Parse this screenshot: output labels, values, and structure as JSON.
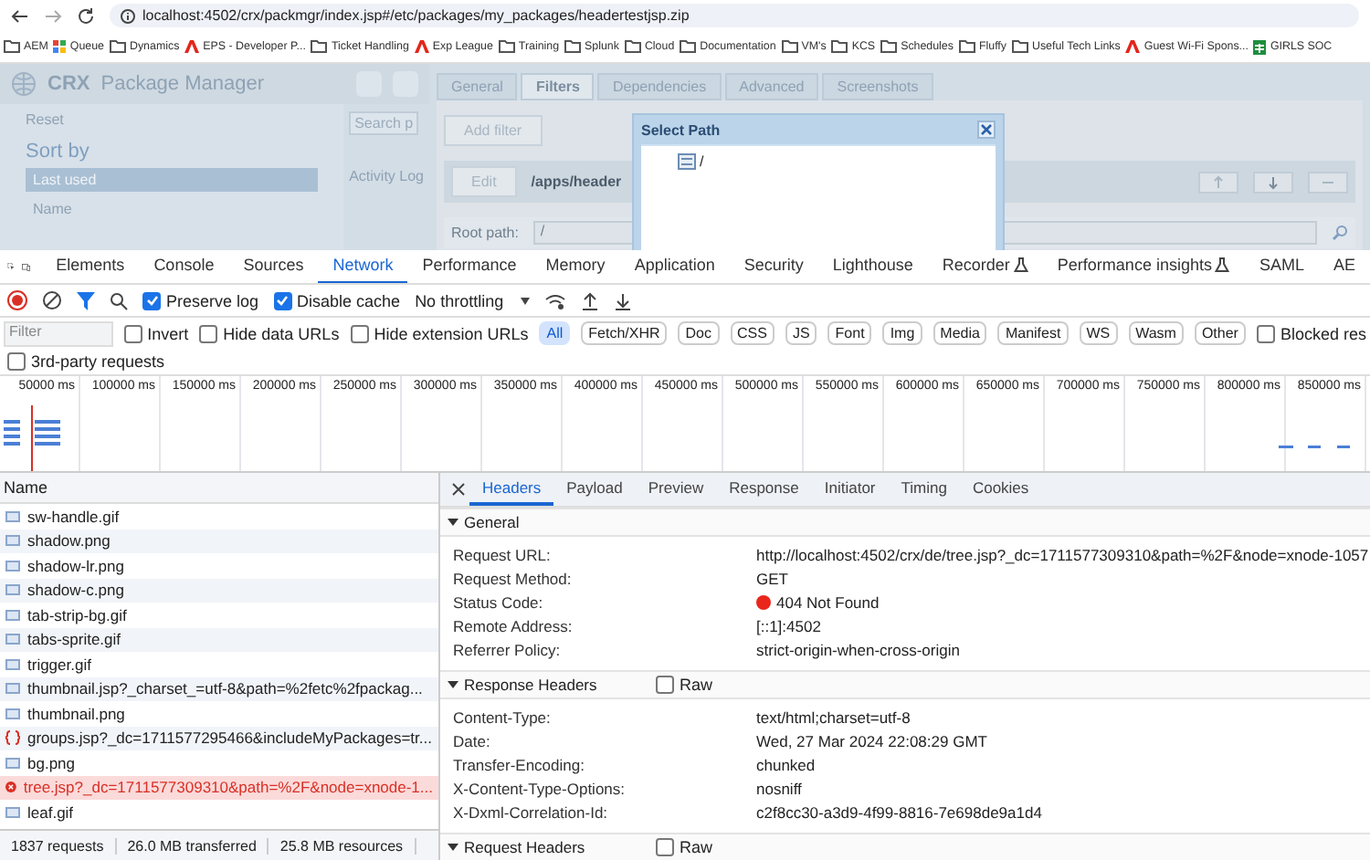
{
  "browser": {
    "address": "localhost:4502/crx/packmgr/index.jsp#/etc/packages/my_packages/headertestjsp.zip",
    "bookmarks": [
      {
        "label": "AEM",
        "kind": "folder"
      },
      {
        "label": "Queue",
        "kind": "app"
      },
      {
        "label": "Dynamics",
        "kind": "folder"
      },
      {
        "label": "EPS - Developer P...",
        "kind": "adobe"
      },
      {
        "label": "Ticket Handling",
        "kind": "folder"
      },
      {
        "label": "Exp League",
        "kind": "adobe"
      },
      {
        "label": "Training",
        "kind": "folder"
      },
      {
        "label": "Splunk",
        "kind": "folder"
      },
      {
        "label": "Cloud",
        "kind": "folder"
      },
      {
        "label": "Documentation",
        "kind": "folder"
      },
      {
        "label": "VM's",
        "kind": "folder"
      },
      {
        "label": "KCS",
        "kind": "folder"
      },
      {
        "label": "Schedules",
        "kind": "folder"
      },
      {
        "label": "Fluffy",
        "kind": "folder"
      },
      {
        "label": "Useful Tech Links",
        "kind": "folder"
      },
      {
        "label": "Guest Wi-Fi Spons...",
        "kind": "adobe"
      },
      {
        "label": "GIRLS SOC",
        "kind": "sheet"
      }
    ]
  },
  "crx": {
    "logo_a": "CRX",
    "logo_b": "Package Manager",
    "reset": "Reset",
    "search_placeholder": "Search p",
    "sort_title": "Sort by",
    "sort_options": [
      {
        "label": "Last used",
        "selected": true
      },
      {
        "label": "Name",
        "selected": false
      }
    ],
    "activity_log": "Activity Log",
    "tabs": [
      {
        "label": "General",
        "selected": false
      },
      {
        "label": "Filters",
        "selected": true
      },
      {
        "label": "Dependencies",
        "selected": false
      },
      {
        "label": "Advanced",
        "selected": false
      },
      {
        "label": "Screenshots",
        "selected": false
      }
    ],
    "add_filter": "Add filter",
    "edit": "Edit",
    "filter_path": "/apps/header",
    "root_path_label": "Root path:",
    "root_path_value": "/",
    "dialog": {
      "title": "Select Path",
      "tree_root": "/"
    }
  },
  "devtools": {
    "tabs": [
      {
        "label": "Elements",
        "selected": false,
        "experimental": false
      },
      {
        "label": "Console",
        "selected": false,
        "experimental": false
      },
      {
        "label": "Sources",
        "selected": false,
        "experimental": false
      },
      {
        "label": "Network",
        "selected": true,
        "experimental": false
      },
      {
        "label": "Performance",
        "selected": false,
        "experimental": false
      },
      {
        "label": "Memory",
        "selected": false,
        "experimental": false
      },
      {
        "label": "Application",
        "selected": false,
        "experimental": false
      },
      {
        "label": "Security",
        "selected": false,
        "experimental": false
      },
      {
        "label": "Lighthouse",
        "selected": false,
        "experimental": false
      },
      {
        "label": "Recorder",
        "selected": false,
        "experimental": true
      },
      {
        "label": "Performance insights",
        "selected": false,
        "experimental": true
      },
      {
        "label": "SAML",
        "selected": false,
        "experimental": false
      },
      {
        "label": "AE",
        "selected": false,
        "experimental": false
      }
    ],
    "preserve_log": {
      "label": "Preserve log",
      "checked": true
    },
    "disable_cache": {
      "label": "Disable cache",
      "checked": true
    },
    "throttling": "No throttling",
    "filter_placeholder": "Filter",
    "filter_options": [
      {
        "label": "Invert",
        "checked": false
      },
      {
        "label": "Hide data URLs",
        "checked": false
      },
      {
        "label": "Hide extension URLs",
        "checked": false
      }
    ],
    "types": [
      {
        "label": "All",
        "selected": true
      },
      {
        "label": "Fetch/XHR",
        "selected": false
      },
      {
        "label": "Doc",
        "selected": false
      },
      {
        "label": "CSS",
        "selected": false
      },
      {
        "label": "JS",
        "selected": false
      },
      {
        "label": "Font",
        "selected": false
      },
      {
        "label": "Img",
        "selected": false
      },
      {
        "label": "Media",
        "selected": false
      },
      {
        "label": "Manifest",
        "selected": false
      },
      {
        "label": "WS",
        "selected": false
      },
      {
        "label": "Wasm",
        "selected": false
      },
      {
        "label": "Other",
        "selected": false
      }
    ],
    "blocked": {
      "label": "Blocked res",
      "checked": false
    },
    "third_party": {
      "label": "3rd-party requests",
      "checked": false
    },
    "timeline_ticks": [
      "50000 ms",
      "100000 ms",
      "150000 ms",
      "200000 ms",
      "250000 ms",
      "300000 ms",
      "350000 ms",
      "400000 ms",
      "450000 ms",
      "500000 ms",
      "550000 ms",
      "600000 ms",
      "650000 ms",
      "700000 ms",
      "750000 ms",
      "800000 ms",
      "850000 ms"
    ],
    "name_header": "Name",
    "requests": [
      {
        "name": "sw-handle.gif",
        "kind": "image",
        "selected": false
      },
      {
        "name": "shadow.png",
        "kind": "image",
        "selected": false
      },
      {
        "name": "shadow-lr.png",
        "kind": "image",
        "selected": false
      },
      {
        "name": "shadow-c.png",
        "kind": "image",
        "selected": false
      },
      {
        "name": "tab-strip-bg.gif",
        "kind": "image",
        "selected": false
      },
      {
        "name": "tabs-sprite.gif",
        "kind": "image",
        "selected": false
      },
      {
        "name": "trigger.gif",
        "kind": "image",
        "selected": false
      },
      {
        "name": "thumbnail.jsp?_charset_=utf-8&path=%2fetc%2fpackag...",
        "kind": "image",
        "selected": false
      },
      {
        "name": "thumbnail.png",
        "kind": "image",
        "selected": false
      },
      {
        "name": "groups.jsp?_dc=1711577295466&includeMyPackages=tr...",
        "kind": "json",
        "selected": false
      },
      {
        "name": "bg.png",
        "kind": "image",
        "selected": false
      },
      {
        "name": "tree.jsp?_dc=1711577309310&path=%2F&node=xnode-1...",
        "kind": "error",
        "selected": true
      },
      {
        "name": "leaf.gif",
        "kind": "image",
        "selected": false
      }
    ],
    "summary": [
      "1837 requests",
      "26.0 MB transferred",
      "25.8 MB resources"
    ],
    "detail_tabs": [
      {
        "label": "Headers",
        "selected": true
      },
      {
        "label": "Payload",
        "selected": false
      },
      {
        "label": "Preview",
        "selected": false
      },
      {
        "label": "Response",
        "selected": false
      },
      {
        "label": "Initiator",
        "selected": false
      },
      {
        "label": "Timing",
        "selected": false
      },
      {
        "label": "Cookies",
        "selected": false
      }
    ],
    "sections": [
      {
        "title": "General",
        "expanded": true,
        "rows": [
          {
            "key": "Request URL:",
            "value": "http://localhost:4502/crx/de/tree.jsp?_dc=1711577309310&path=%2F&node=xnode-1057",
            "kind": "text"
          },
          {
            "key": "Request Method:",
            "value": "GET",
            "kind": "text"
          },
          {
            "key": "Status Code:",
            "value": "404 Not Found",
            "kind": "status"
          },
          {
            "key": "Remote Address:",
            "value": "[::1]:4502",
            "kind": "text"
          },
          {
            "key": "Referrer Policy:",
            "value": "strict-origin-when-cross-origin",
            "kind": "text"
          }
        ]
      },
      {
        "title": "Response Headers",
        "expanded": true,
        "raw": {
          "label": "Raw",
          "checked": false
        },
        "rows": [
          {
            "key": "Content-Type:",
            "value": "text/html;charset=utf-8",
            "kind": "text"
          },
          {
            "key": "Date:",
            "value": "Wed, 27 Mar 2024 22:08:29 GMT",
            "kind": "text"
          },
          {
            "key": "Transfer-Encoding:",
            "value": "chunked",
            "kind": "text"
          },
          {
            "key": "X-Content-Type-Options:",
            "value": "nosniff",
            "kind": "text"
          },
          {
            "key": "X-Dxml-Correlation-Id:",
            "value": "c2f8cc30-a3d9-4f99-8816-7e698de9a1d4",
            "kind": "text"
          }
        ]
      },
      {
        "title": "Request Headers",
        "expanded": true,
        "raw": {
          "label": "Raw",
          "checked": false
        }
      }
    ]
  }
}
